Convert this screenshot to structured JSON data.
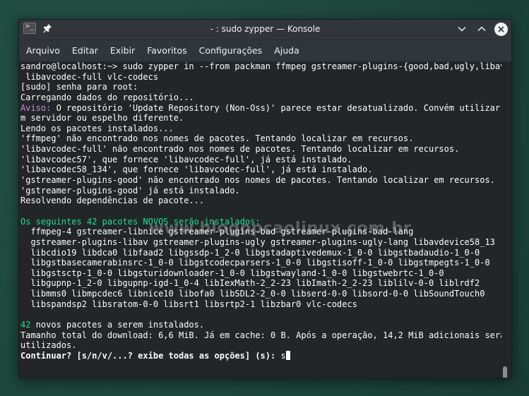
{
  "window": {
    "title": "- : sudo zypper — Konsole",
    "icons": [
      "konsole-icon",
      "pin-icon",
      "minimize-icon",
      "maximize-icon",
      "close-icon"
    ]
  },
  "menu": [
    "Arquivo",
    "Editar",
    "Exibir",
    "Favoritos",
    "Configurações",
    "Ajuda"
  ],
  "watermark": "www.blogopcaolinux.com.br",
  "terminal": {
    "lines": [
      {
        "t": "sandro@localhost:~> sudo zypper in --from packman ffmpeg gstreamer-plugins-{good,bad,ugly,libav}"
      },
      {
        "t": " libavcodec-full vlc-codecs"
      },
      {
        "t": "[sudo] senha para root:"
      },
      {
        "t": "Carregando dados do repositório..."
      },
      {
        "p": "Aviso:",
        "t": " O repositório 'Update Repository (Non-Oss)' parece estar desatualizado. Convém utilizar u"
      },
      {
        "t": "m servidor ou espelho diferente."
      },
      {
        "t": "Lendo os pacotes instalados..."
      },
      {
        "t": "'ffmpeg' não encontrado nos nomes de pacotes. Tentando localizar em recursos."
      },
      {
        "t": "'libavcodec-full' não encontrado nos nomes de pacotes. Tentando localizar em recursos."
      },
      {
        "t": "'libavcodec57', que fornece 'libavcodec-full', já está instalado."
      },
      {
        "t": "'libavcodec58_134', que fornece 'libavcodec-full', já está instalado."
      },
      {
        "t": "'gstreamer-plugins-good' não encontrado nos nomes de pacotes. Tentando localizar em recursos."
      },
      {
        "t": "'gstreamer-plugins-good' já está instalado."
      },
      {
        "t": "Resolvendo dependências de pacote..."
      },
      {
        "t": ""
      },
      {
        "g": "Os seguintes 42 pacotes NOVOS serão instalados:"
      },
      {
        "t": "  ffmpeg-4 gstreamer-libnice gstreamer-plugins-bad gstreamer-plugins-bad-lang"
      },
      {
        "t": "  gstreamer-plugins-libav gstreamer-plugins-ugly gstreamer-plugins-ugly-lang libavdevice58_13"
      },
      {
        "t": "  libcdio19 libdca0 libfaad2 libgssdp-1_2-0 libgstadaptivedemux-1_0-0 libgstbadaudio-1_0-0"
      },
      {
        "t": "  libgstbasecamerabinsrc-1_0-0 libgstcodecparsers-1_0-0 libgstisoff-1_0-0 libgstmpegts-1_0-0"
      },
      {
        "t": "  libgstsctp-1_0-0 libgsturidownloader-1_0-0 libgstwayland-1_0-0 libgstwebrtc-1_0-0"
      },
      {
        "t": "  libgupnp-1_2-0 libgupnp-igd-1_0-4 libIexMath-2_2-23 libImath-2_2-23 liblilv-0-0 liblrdf2"
      },
      {
        "t": "  libmms0 libmpcdec6 libnice10 libofa0 libSDL2-2_0-0 libserd-0-0 libsord-0-0 libSoundTouch0"
      },
      {
        "t": "  libspandsp2 libsratom-0-0 libsrt1 libsrtp2-1 libzbar0 vlc-codecs"
      },
      {
        "t": ""
      },
      {
        "g": "42",
        "t": " novos pacotes a serem instalados."
      },
      {
        "t": "Tamanho total do download: 6,6 MiB. Já em cache: 0 B. Após a operação, 14,2 MiB adicionais serão"
      },
      {
        "t": "utilizados."
      },
      {
        "b": "Continuar? [s/n/v/...? exibe todas as opções] (s): ",
        "t": "s",
        "cursor": true
      }
    ]
  }
}
